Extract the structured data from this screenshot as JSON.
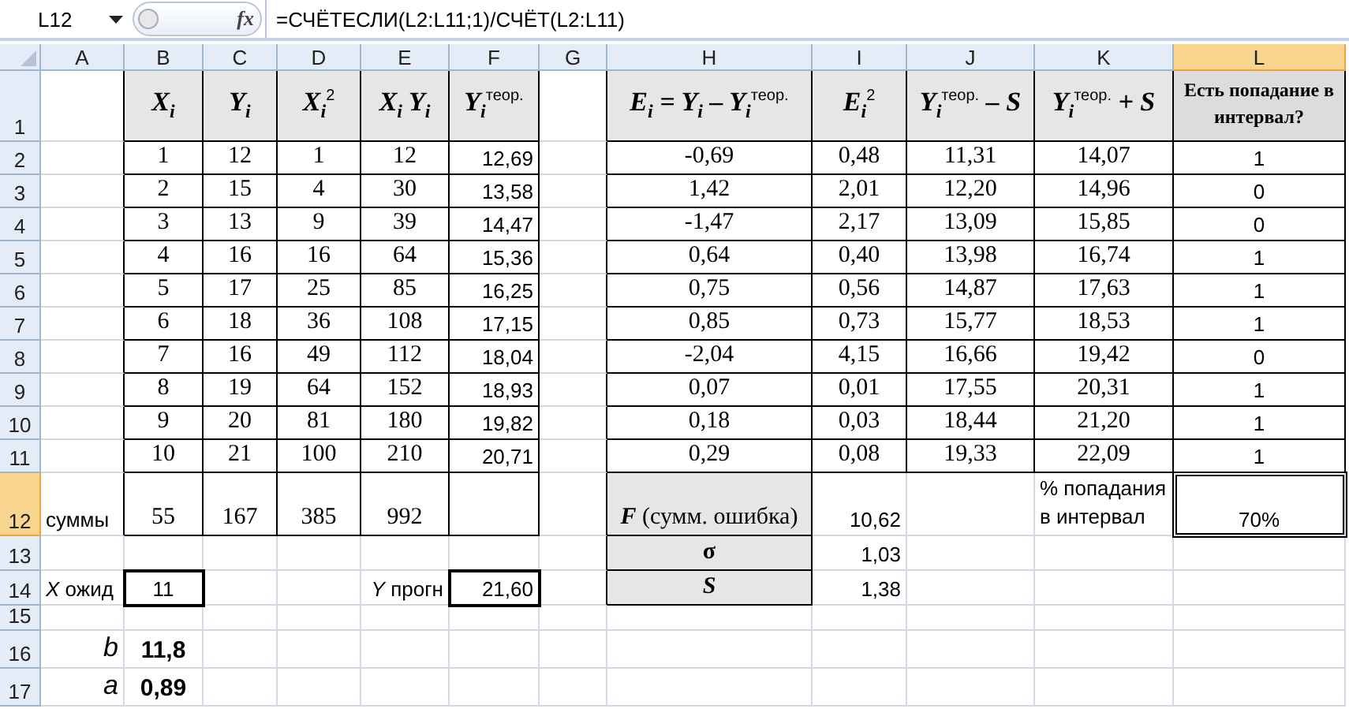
{
  "formula_bar": {
    "name_box": "L12",
    "fx_label": "fx",
    "formula": "=СЧЁТЕСЛИ(L2:L11;1)/СЧЁТ(L2:L11)"
  },
  "columns": [
    {
      "label": "A",
      "selected": false
    },
    {
      "label": "B",
      "selected": false
    },
    {
      "label": "C",
      "selected": false
    },
    {
      "label": "D",
      "selected": false
    },
    {
      "label": "E",
      "selected": false
    },
    {
      "label": "F",
      "selected": false
    },
    {
      "label": "G",
      "selected": false
    },
    {
      "label": "H",
      "selected": false
    },
    {
      "label": "I",
      "selected": false
    },
    {
      "label": "J",
      "selected": false
    },
    {
      "label": "K",
      "selected": false
    },
    {
      "label": "L",
      "selected": true
    }
  ],
  "rows": [
    {
      "number": "1",
      "selected": false,
      "cells": [
        null,
        "X$_{i}$",
        "Y$_{i}$",
        "X$_{i}$$^{2}$",
        "X$_{i}$ Y$_{i}$",
        "Y$_{i}$$^{теор.}$",
        null,
        "E$_{i}$ = Y$_{i}$ – Y$_{i}$$^{теор.}$",
        "E$_{i}$$^{2}$",
        "Y$_{i}$$^{теор.}$ – S",
        "Y$_{i}$$^{теор.}$ + S",
        "Есть попадание в интервал?"
      ]
    },
    {
      "number": "2",
      "selected": false,
      "cells": [
        null,
        "1",
        "12",
        "1",
        "12",
        "12,69",
        null,
        "-0,69",
        "0,48",
        "11,31",
        "14,07",
        "1"
      ]
    },
    {
      "number": "3",
      "selected": false,
      "cells": [
        null,
        "2",
        "15",
        "4",
        "30",
        "13,58",
        null,
        "1,42",
        "2,01",
        "12,20",
        "14,96",
        "0"
      ]
    },
    {
      "number": "4",
      "selected": false,
      "cells": [
        null,
        "3",
        "13",
        "9",
        "39",
        "14,47",
        null,
        "-1,47",
        "2,17",
        "13,09",
        "15,85",
        "0"
      ]
    },
    {
      "number": "5",
      "selected": false,
      "cells": [
        null,
        "4",
        "16",
        "16",
        "64",
        "15,36",
        null,
        "0,64",
        "0,40",
        "13,98",
        "16,74",
        "1"
      ]
    },
    {
      "number": "6",
      "selected": false,
      "cells": [
        null,
        "5",
        "17",
        "25",
        "85",
        "16,25",
        null,
        "0,75",
        "0,56",
        "14,87",
        "17,63",
        "1"
      ]
    },
    {
      "number": "7",
      "selected": false,
      "cells": [
        null,
        "6",
        "18",
        "36",
        "108",
        "17,15",
        null,
        "0,85",
        "0,73",
        "15,77",
        "18,53",
        "1"
      ]
    },
    {
      "number": "8",
      "selected": false,
      "cells": [
        null,
        "7",
        "16",
        "49",
        "112",
        "18,04",
        null,
        "-2,04",
        "4,15",
        "16,66",
        "19,42",
        "0"
      ]
    },
    {
      "number": "9",
      "selected": false,
      "cells": [
        null,
        "8",
        "19",
        "64",
        "152",
        "18,93",
        null,
        "0,07",
        "0,01",
        "17,55",
        "20,31",
        "1"
      ]
    },
    {
      "number": "10",
      "selected": false,
      "cells": [
        null,
        "9",
        "20",
        "81",
        "180",
        "19,82",
        null,
        "0,18",
        "0,03",
        "18,44",
        "21,20",
        "1"
      ]
    },
    {
      "number": "11",
      "selected": false,
      "cells": [
        null,
        "10",
        "21",
        "100",
        "210",
        "20,71",
        null,
        "0,29",
        "0,08",
        "19,33",
        "22,09",
        "1"
      ]
    },
    {
      "number": "12",
      "selected": true,
      "cells": [
        "суммы",
        "55",
        "167",
        "385",
        "992",
        null,
        null,
        "**F** (сумм. ошибка)",
        "10,62",
        null,
        "% попадания в интервал",
        "70%"
      ]
    },
    {
      "number": "13",
      "selected": false,
      "cells": [
        null,
        null,
        null,
        null,
        null,
        null,
        null,
        "σ",
        "1,03",
        null,
        null,
        null
      ]
    },
    {
      "number": "14",
      "selected": false,
      "cells": [
        "*X* ожид",
        "11",
        null,
        null,
        "*Y* прогн",
        "21,60",
        null,
        "S",
        "1,38",
        null,
        null,
        null
      ]
    },
    {
      "number": "15",
      "selected": false,
      "cells": [
        null,
        null,
        null,
        null,
        null,
        null,
        null,
        null,
        null,
        null,
        null,
        null
      ]
    },
    {
      "number": "16",
      "selected": false,
      "cells": [
        "b",
        "11,8",
        null,
        null,
        null,
        null,
        null,
        null,
        null,
        null,
        null,
        null
      ]
    },
    {
      "number": "17",
      "selected": false,
      "cells": [
        "a",
        "0,89",
        null,
        null,
        null,
        null,
        null,
        null,
        null,
        null,
        null,
        null
      ]
    }
  ]
}
